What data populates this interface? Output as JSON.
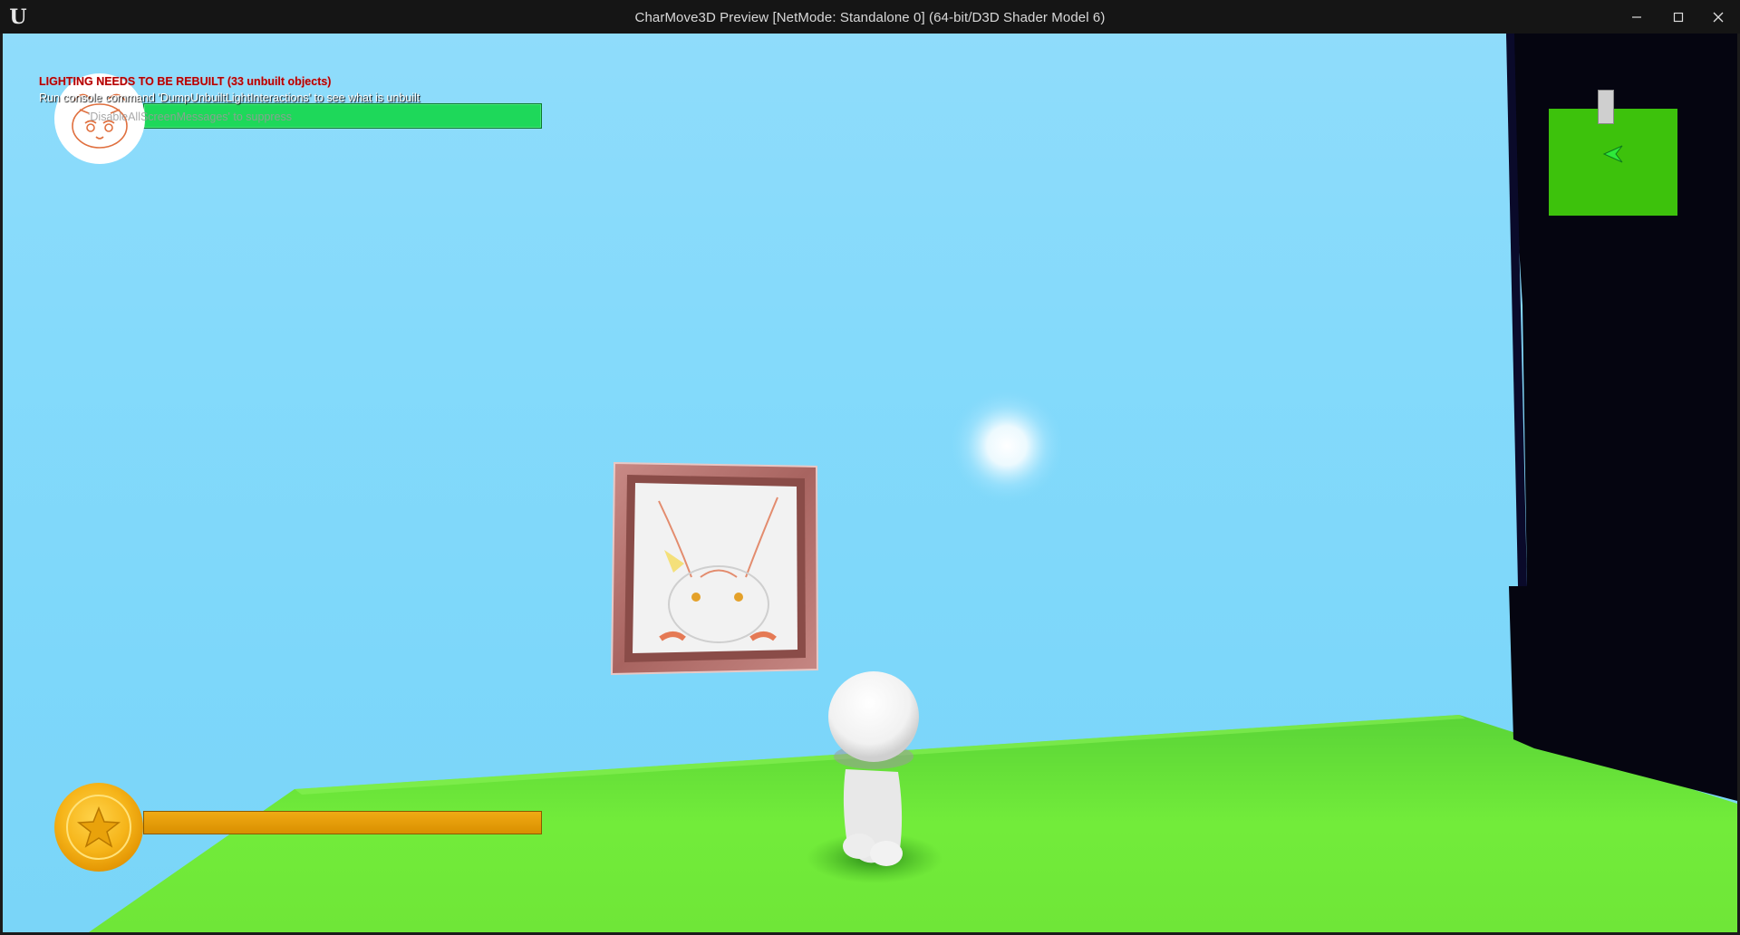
{
  "window": {
    "title": "CharMove3D Preview [NetMode: Standalone 0]  (64-bit/D3D Shader Model 6)",
    "logo_glyph": "U",
    "controls": [
      "minimize",
      "maximize",
      "close"
    ]
  },
  "hud": {
    "warning_title": "LIGHTING NEEDS TO BE REBUILT (33 unbuilt objects)",
    "warning_detail": "Run console command 'DumpUnbuiltLightInteractions' to see what is unbuilt",
    "suppress_hint": "'DisableAllScreenMessages' to suppress",
    "health_fill": 1.0,
    "coin_fill": 1.0
  },
  "colors": {
    "sky": "#84dafb",
    "ground": "#6ce838",
    "health_bar": "#1ed85a",
    "coin_bar": "#e89c06",
    "minimap": "#3dc20c",
    "warning_red": "#b30000"
  },
  "icons": {
    "ue_logo": "unreal-logo-icon",
    "portrait": "character-portrait-icon",
    "coin": "star-coin-icon",
    "minimap_player": "player-arrow-icon"
  }
}
